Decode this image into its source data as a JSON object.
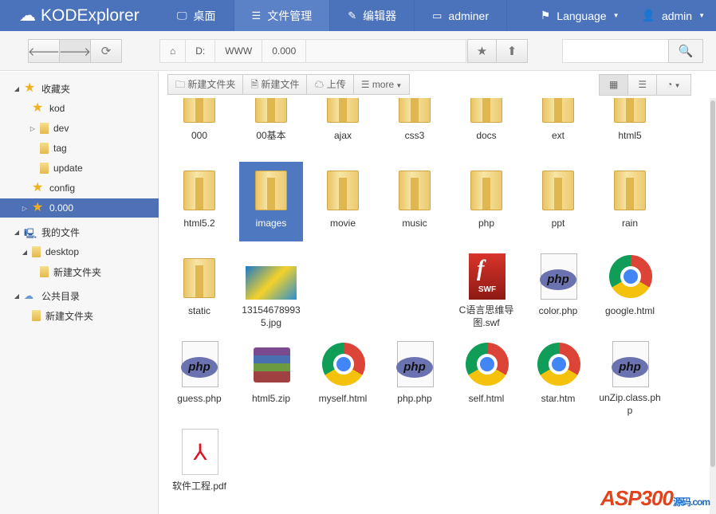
{
  "app": {
    "title": "KODExplorer"
  },
  "nav": [
    {
      "label": "桌面"
    },
    {
      "label": "文件管理"
    },
    {
      "label": "编辑器"
    },
    {
      "label": "adminer"
    }
  ],
  "language": "Language",
  "user": "admin",
  "path": [
    "D:",
    "WWW",
    "0.000"
  ],
  "search": {
    "value": "",
    "placeholder": ""
  },
  "toolbar": {
    "new_folder": "新建文件夹",
    "new_file": "新建文件",
    "upload": "上传",
    "more": "more"
  },
  "tree": [
    {
      "label": "收藏夹"
    },
    {
      "label": "kod"
    },
    {
      "label": "dev"
    },
    {
      "label": "tag"
    },
    {
      "label": "update"
    },
    {
      "label": "config"
    },
    {
      "label": "0.000"
    },
    {
      "label": "我的文件"
    },
    {
      "label": "desktop"
    },
    {
      "label": "新建文件夹"
    },
    {
      "label": "公共目录"
    },
    {
      "label": "新建文件夹"
    }
  ],
  "files": [
    {
      "name": "000",
      "type": "folder"
    },
    {
      "name": "00基本",
      "type": "folder"
    },
    {
      "name": "ajax",
      "type": "folder"
    },
    {
      "name": "css3",
      "type": "folder"
    },
    {
      "name": "docs",
      "type": "folder"
    },
    {
      "name": "ext",
      "type": "folder"
    },
    {
      "name": "html5",
      "type": "folder"
    },
    {
      "name": "html5.2",
      "type": "folder"
    },
    {
      "name": "images",
      "type": "folder",
      "selected": true
    },
    {
      "name": "movie",
      "type": "folder"
    },
    {
      "name": "music",
      "type": "folder"
    },
    {
      "name": "php",
      "type": "folder"
    },
    {
      "name": "ppt",
      "type": "folder"
    },
    {
      "name": "rain",
      "type": "folder"
    },
    {
      "name": "static",
      "type": "folder"
    },
    {
      "name": "131546789935.jpg",
      "type": "jpg"
    },
    {
      "name": "C语言思维导图.swf",
      "type": "swf"
    },
    {
      "name": "color.php",
      "type": "php"
    },
    {
      "name": "google.html",
      "type": "html"
    },
    {
      "name": "guess.php",
      "type": "php"
    },
    {
      "name": "html5.zip",
      "type": "zip"
    },
    {
      "name": "myself.html",
      "type": "html"
    },
    {
      "name": "php.php",
      "type": "php"
    },
    {
      "name": "self.html",
      "type": "html"
    },
    {
      "name": "star.htm",
      "type": "html"
    },
    {
      "name": "unZip.class.php",
      "type": "php"
    },
    {
      "name": "软件工程.pdf",
      "type": "pdf"
    }
  ],
  "watermark": {
    "text": "ASP300",
    "sub": "源码 .com"
  }
}
